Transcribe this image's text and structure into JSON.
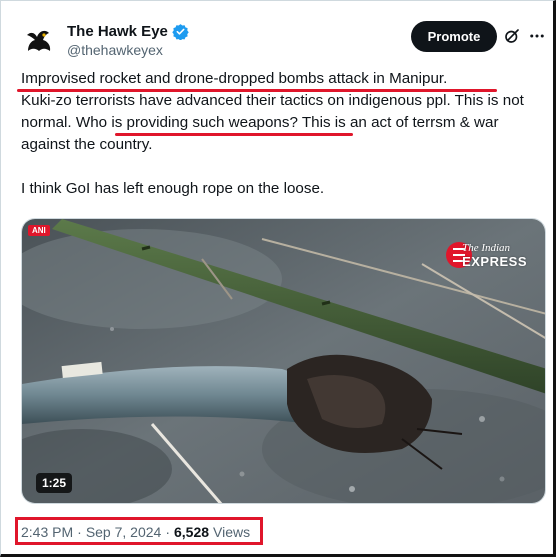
{
  "author": {
    "display_name": "The Hawk Eye",
    "handle": "@thehawkeyex",
    "verified": true,
    "avatar_icon": "hawk-silhouette-icon"
  },
  "actions": {
    "promote_label": "Promote",
    "grok_icon": "grok-icon",
    "more_icon": "more-dots-icon"
  },
  "tweet": {
    "line1": "Improvised rocket and drone-dropped bombs attack in Manipur.",
    "line2": "Kuki-zo terrorists have advanced their tactics on indigenous ppl. This is not normal.",
    "line3_highlight": "Who is providing such weapons?",
    "line3_rest": "This is an act of terrsm & war against the country.",
    "para2": "I think GoI has left enough rope on the loose."
  },
  "media": {
    "duration": "1:25",
    "source_badge": "ANI",
    "brand_line1": "The Indian",
    "brand_line2": "EXPRESS"
  },
  "meta": {
    "time": "2:43 PM",
    "separator": "·",
    "date": "Sep 7, 2024",
    "views_count": "6,528",
    "views_label": "Views"
  },
  "colors": {
    "accent_red": "#e0162b",
    "text_primary": "#0f1419",
    "text_secondary": "#536471",
    "verified_blue": "#1d9bf0"
  }
}
